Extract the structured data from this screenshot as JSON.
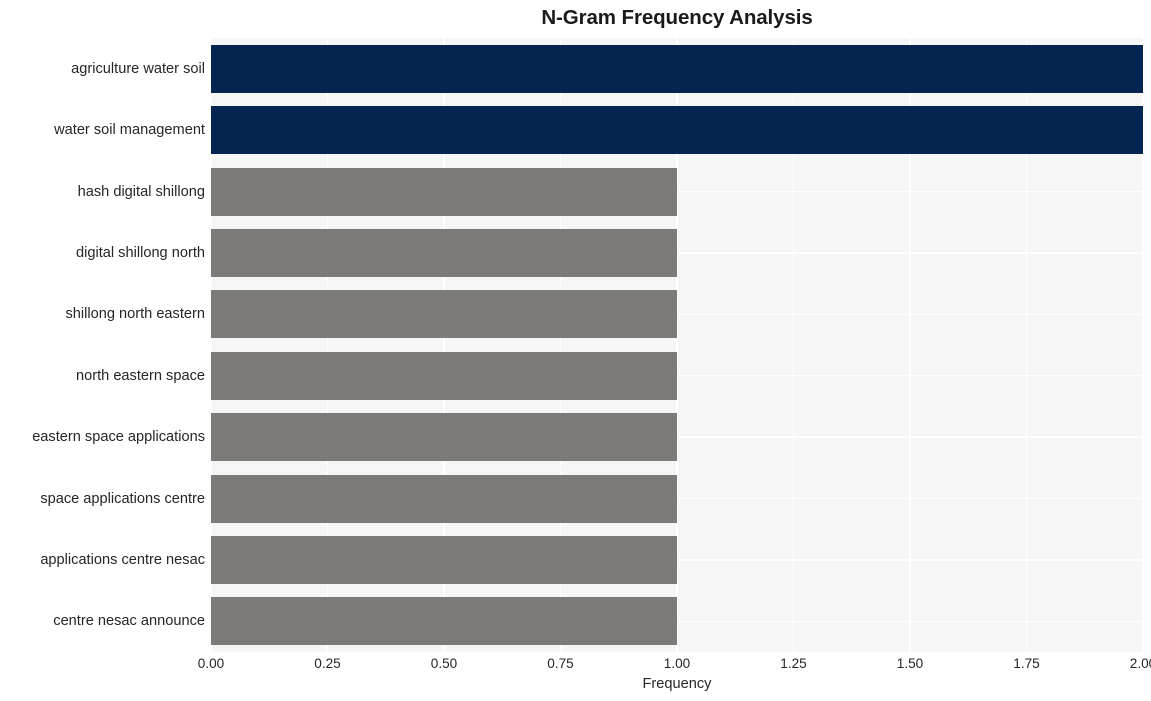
{
  "chart_data": {
    "type": "bar",
    "orientation": "horizontal",
    "title": "N-Gram Frequency Analysis",
    "xlabel": "Frequency",
    "ylabel": "",
    "categories": [
      "agriculture water soil",
      "water soil management",
      "hash digital shillong",
      "digital shillong north",
      "shillong north eastern",
      "north eastern space",
      "eastern space applications",
      "space applications centre",
      "applications centre nesac",
      "centre nesac announce"
    ],
    "values": [
      2,
      2,
      1,
      1,
      1,
      1,
      1,
      1,
      1,
      1
    ],
    "bar_colors": [
      "#042550",
      "#042550",
      "#7c7b78",
      "#7c7b78",
      "#7c7b78",
      "#7c7b78",
      "#7c7b78",
      "#7c7b78",
      "#7c7b78",
      "#7c7b78"
    ],
    "xlim": [
      0,
      2
    ],
    "xticks": [
      0,
      0.25,
      0.5,
      0.75,
      1,
      1.25,
      1.5,
      1.75,
      2
    ],
    "xticklabels": [
      "0.00",
      "0.25",
      "0.50",
      "0.75",
      "1.00",
      "1.25",
      "1.50",
      "1.75",
      "2.00"
    ],
    "grid": true,
    "legend": null,
    "plot_background": "#f6f6f7",
    "grid_color": "#ffffff",
    "figure_background": "#ffffff"
  }
}
